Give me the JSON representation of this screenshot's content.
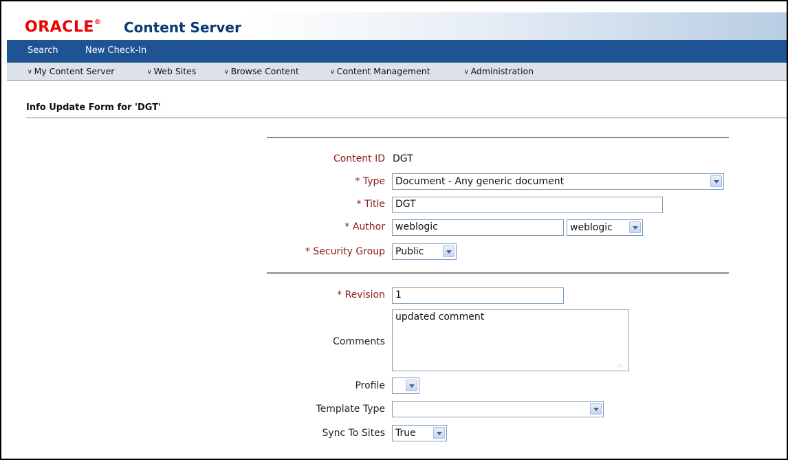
{
  "app": {
    "logo_text": "ORACLE",
    "logo_mark": "®",
    "title": "Content Server",
    "colors": {
      "brand_red": "#ee0000",
      "nav_blue": "#1e5394",
      "label_red": "#8b1a1a"
    }
  },
  "primary_nav": [
    "Search",
    "New Check-In"
  ],
  "secondary_nav": [
    "My Content Server",
    "Web Sites",
    "Browse Content",
    "Content Management",
    "Administration"
  ],
  "page_title": "Info Update Form for 'DGT'",
  "form": {
    "content_id": {
      "label": "Content ID",
      "value": "DGT"
    },
    "type": {
      "label": "* Type",
      "value": "Document - Any generic document"
    },
    "title": {
      "label": "* Title",
      "value": "DGT"
    },
    "author": {
      "label": "* Author",
      "value": "weblogic",
      "select_value": "weblogic"
    },
    "security_group": {
      "label": "* Security Group",
      "value": "Public"
    },
    "revision": {
      "label": "* Revision",
      "value": "1"
    },
    "comments": {
      "label": "Comments",
      "value": "updated comment"
    },
    "profile": {
      "label": "Profile",
      "value": ""
    },
    "template_type": {
      "label": "Template Type",
      "value": ""
    },
    "sync_to_sites": {
      "label": "Sync To Sites",
      "value": "True"
    }
  },
  "icons": {
    "dropdown": "chevron-down-icon",
    "nav_menu": "chevron-down-icon",
    "resize": "resize-grip-icon"
  }
}
